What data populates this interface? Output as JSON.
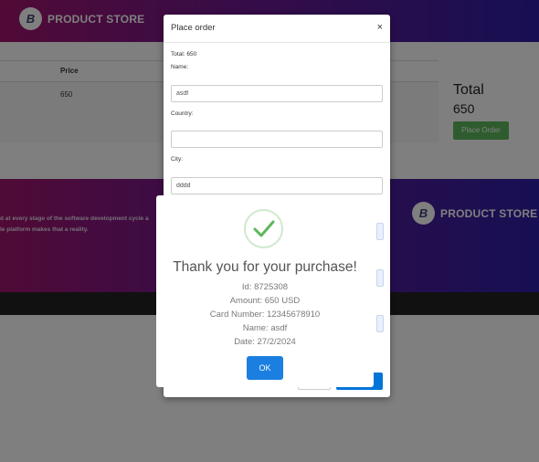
{
  "header": {
    "brand": "PRODUCT STORE",
    "logo_letter": "B"
  },
  "cart": {
    "column_price": "Price",
    "row_price": "650",
    "total_label": "Total",
    "total_value": "650",
    "place_order_button": "Place Order"
  },
  "footer": {
    "brand": "PRODUCT STORE",
    "about_line1": "d at every stage of the software development cycle a",
    "about_line2": "le platform makes that a reality."
  },
  "modal": {
    "title": "Place order",
    "close_symbol": "×",
    "total_text": "Total: 650",
    "fields": {
      "name": {
        "label": "Name:",
        "value": "asdf"
      },
      "country": {
        "label": "Country:",
        "value": ""
      },
      "city": {
        "label": "City:",
        "value": "dddd"
      }
    }
  },
  "alert": {
    "icon": "success-check-icon",
    "accent_color": "#5cb85c",
    "title": "Thank you for your purchase!",
    "lines": {
      "id": "Id: 8725308",
      "amount": "Amount: 650 USD",
      "card": "Card Number: 12345678910",
      "name": "Name: asdf",
      "date": "Date: 27/2/2024"
    },
    "ok_button": "OK"
  }
}
